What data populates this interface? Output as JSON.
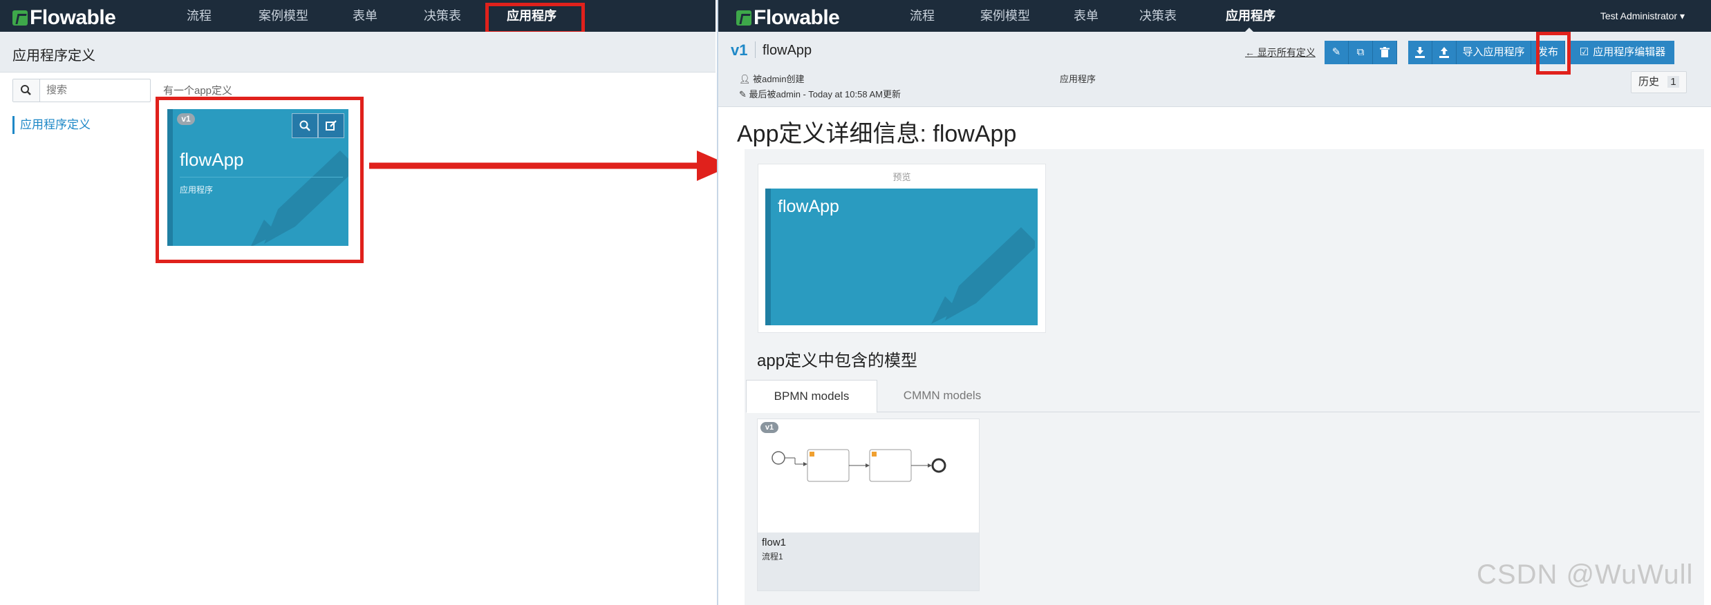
{
  "brand": "Flowable",
  "nav": [
    "流程",
    "案例模型",
    "表单",
    "决策表",
    "应用程序"
  ],
  "left": {
    "page_title": "应用程序定义",
    "search_placeholder": "搜索",
    "count_text": "有一个app定义",
    "sidebar_link": "应用程序定义",
    "card": {
      "version": "v1",
      "name": "flowApp",
      "description": "应用程序"
    }
  },
  "right": {
    "user_menu": "Test Administrator",
    "version": "v1",
    "app_name": "flowApp",
    "back_link": "← 显示所有定义",
    "created_by": "被admin创建",
    "modified_by": "最后被admin - Today at 10:58 AM更新",
    "type_label": "应用程序",
    "import_label": "导入应用程序",
    "publish_label": "发布",
    "editor_label": "应用程序编辑器",
    "history_label": "历史",
    "history_count": "1",
    "detail_title": "App定义详细信息: flowApp",
    "preview_label": "预览",
    "preview_name": "flowApp",
    "models_title": "app定义中包含的模型",
    "tabs": [
      "BPMN models",
      "CMMN models"
    ],
    "model": {
      "version": "v1",
      "name": "flow1",
      "description": "流程1"
    }
  },
  "watermark": "CSDN @WuWull",
  "colors": {
    "navbar": "#1d2c3b",
    "accent": "#2b86c4",
    "card": "#2a9bc0",
    "highlight": "#e0211c"
  }
}
